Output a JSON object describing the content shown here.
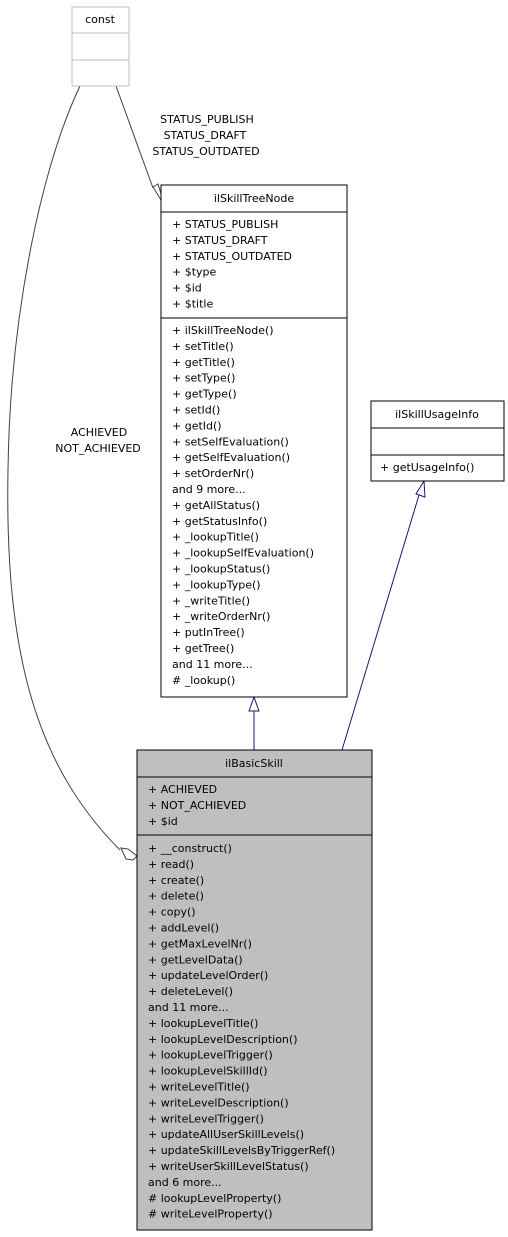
{
  "diagram": {
    "type": "UML class collaboration diagram",
    "classes": {
      "const": {
        "name": "const",
        "attributes": [],
        "methods": []
      },
      "ilSkillTreeNode": {
        "name": "ilSkillTreeNode",
        "attributes": [
          "+ STATUS_PUBLISH",
          "+ STATUS_DRAFT",
          "+ STATUS_OUTDATED",
          "+ $type",
          "+ $id",
          "+ $title"
        ],
        "methods": [
          "+ ilSkillTreeNode()",
          "+ setTitle()",
          "+ getTitle()",
          "+ setType()",
          "+ getType()",
          "+ setId()",
          "+ getId()",
          "+ setSelfEvaluation()",
          "+ getSelfEvaluation()",
          "+ setOrderNr()",
          "and 9 more...",
          "+ getAllStatus()",
          "+ getStatusInfo()",
          "+ _lookupTitle()",
          "+ _lookupSelfEvaluation()",
          "+ _lookupStatus()",
          "+ _lookupType()",
          "+ _writeTitle()",
          "+ _writeOrderNr()",
          "+ putInTree()",
          "+ getTree()",
          "and 11 more...",
          "# _lookup()"
        ]
      },
      "ilSkillUsageInfo": {
        "name": "ilSkillUsageInfo",
        "attributes": [],
        "methods": [
          "+ getUsageInfo()"
        ]
      },
      "ilBasicSkill": {
        "name": "ilBasicSkill",
        "attributes": [
          "+ ACHIEVED",
          "+ NOT_ACHIEVED",
          "+ $id"
        ],
        "methods": [
          "+ __construct()",
          "+ read()",
          "+ create()",
          "+ delete()",
          "+ copy()",
          "+ addLevel()",
          "+ getMaxLevelNr()",
          "+ getLevelData()",
          "+ updateLevelOrder()",
          "+ deleteLevel()",
          "and 11 more...",
          "+ lookupLevelTitle()",
          "+ lookupLevelDescription()",
          "+ lookupLevelTrigger()",
          "+ lookupLevelSkillId()",
          "+ writeLevelTitle()",
          "+ writeLevelDescription()",
          "+ writeLevelTrigger()",
          "+ updateAllUserSkillLevels()",
          "+ updateSkillLevelsByTriggerRef()",
          "+ writeUserSkillLevelStatus()",
          "and 6 more...",
          "# lookupLevelProperty()",
          "# writeLevelProperty()"
        ]
      }
    },
    "edges": [
      {
        "from": "const",
        "to": "ilSkillTreeNode",
        "kind": "aggregation",
        "labels": [
          "STATUS_PUBLISH",
          "STATUS_DRAFT",
          "STATUS_OUTDATED"
        ]
      },
      {
        "from": "const",
        "to": "ilBasicSkill",
        "kind": "aggregation",
        "labels": [
          "ACHIEVED",
          "NOT_ACHIEVED"
        ]
      },
      {
        "from": "ilBasicSkill",
        "to": "ilSkillTreeNode",
        "kind": "inheritance",
        "labels": []
      },
      {
        "from": "ilBasicSkill",
        "to": "ilSkillUsageInfo",
        "kind": "inheritance",
        "labels": []
      }
    ],
    "colors": {
      "highlight_fill": "#bfbfbf",
      "node_border": "#000000",
      "external_border": "#bfbfbf",
      "inheritance_edge": "#191970",
      "aggregation_edge": "#404040"
    }
  }
}
